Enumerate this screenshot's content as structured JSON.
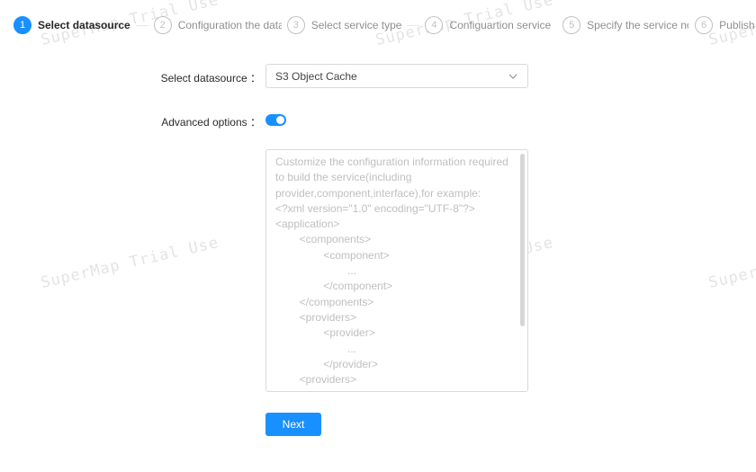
{
  "steps": [
    {
      "number": "1",
      "title": "Select datasource",
      "state": "active"
    },
    {
      "number": "2",
      "title": "Configuration the data",
      "state": "wait"
    },
    {
      "number": "3",
      "title": "Select service type",
      "state": "wait"
    },
    {
      "number": "4",
      "title": "Configuartion service",
      "state": "wait"
    },
    {
      "number": "5",
      "title": "Specify the service node",
      "state": "wait"
    },
    {
      "number": "6",
      "title": "Publish",
      "state": "wait"
    }
  ],
  "form": {
    "datasource_label": "Select datasource ：",
    "datasource_value": "S3 Object Cache",
    "advanced_label": "Advanced options ：",
    "advanced_enabled": true,
    "config_placeholder_lines": [
      "Customize the configuration information required",
      "to build the service(including",
      "provider,component,interface),for example:",
      "<?xml version=\"1.0\" encoding=\"UTF-8\"?>",
      "<application>",
      "        <components>",
      "                <component>",
      "                        ...",
      "                </component>",
      "        </components>",
      "        <providers>",
      "                <provider>",
      "                        ...",
      "                </provider>",
      "        <providers>"
    ],
    "next_label": "Next"
  },
  "watermark": {
    "text": "SuperMap Trial Use"
  },
  "colors": {
    "primary": "#1890ff"
  }
}
